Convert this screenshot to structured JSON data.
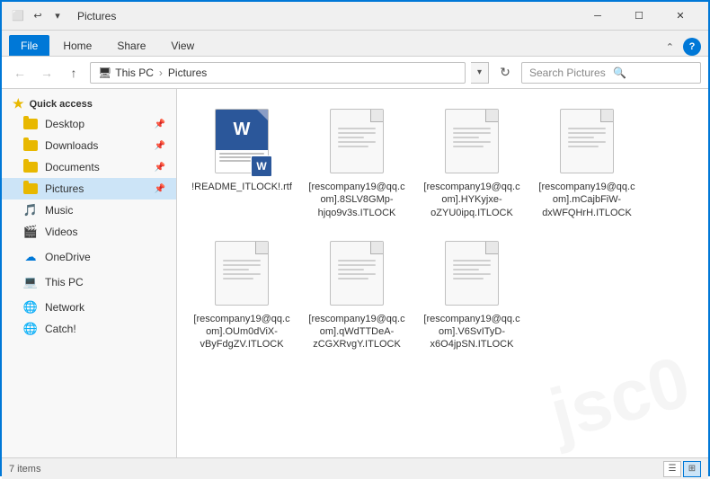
{
  "window": {
    "title": "Pictures",
    "titlebar_icon": "🗂"
  },
  "quickAccessToolbar": {
    "buttons": [
      "properties",
      "new-folder",
      "dropdown"
    ]
  },
  "ribbon": {
    "tabs": [
      "File",
      "Home",
      "Share",
      "View"
    ],
    "active_tab": "File"
  },
  "addressBar": {
    "path_parts": [
      "This PC",
      "Pictures"
    ],
    "search_placeholder": "Search Pictures"
  },
  "sidebar": {
    "quick_access_label": "Quick access",
    "items": [
      {
        "id": "desktop",
        "label": "Desktop",
        "pinned": true,
        "active": false
      },
      {
        "id": "downloads",
        "label": "Downloads",
        "pinned": true,
        "active": false
      },
      {
        "id": "documents",
        "label": "Documents",
        "pinned": true,
        "active": false
      },
      {
        "id": "pictures",
        "label": "Pictures",
        "pinned": true,
        "active": true
      },
      {
        "id": "music",
        "label": "Music",
        "pinned": false,
        "active": false
      },
      {
        "id": "videos",
        "label": "Videos",
        "pinned": false,
        "active": false
      }
    ],
    "onedrive": {
      "label": "OneDrive"
    },
    "this_pc": {
      "label": "This PC"
    },
    "network": {
      "label": "Network"
    },
    "catch": {
      "label": "Catch!"
    }
  },
  "files": [
    {
      "id": "readme",
      "name": "!README_ITLOCK!.rtf",
      "type": "word-rtf",
      "icon": "word"
    },
    {
      "id": "file2",
      "name": "[rescompany19@qq.com].8SLV8GMp-hjqo9v3s.ITLOCK",
      "type": "generic",
      "icon": "generic"
    },
    {
      "id": "file3",
      "name": "[rescompany19@qq.com].HYKyjxe-oZYU0ipq.ITLOCK",
      "type": "generic",
      "icon": "generic"
    },
    {
      "id": "file4",
      "name": "[rescompany19@qq.com].mCajbFiW-dxWFQHrH.ITLOCK",
      "type": "generic",
      "icon": "generic"
    },
    {
      "id": "file5",
      "name": "[rescompany19@qq.com].OUm0dViX-vByFdgZV.ITLOCK",
      "type": "generic",
      "icon": "generic"
    },
    {
      "id": "file6",
      "name": "[rescompany19@qq.com].qWdTTDeA-zCGXRvgY.ITLOCK",
      "type": "generic",
      "icon": "generic"
    },
    {
      "id": "file7",
      "name": "[rescompany19@qq.com].V6SvITyD-x6O4jpSN.ITLOCK",
      "type": "generic",
      "icon": "generic"
    }
  ],
  "statusBar": {
    "item_count": "7 items",
    "views": [
      "list",
      "large-icons"
    ]
  }
}
